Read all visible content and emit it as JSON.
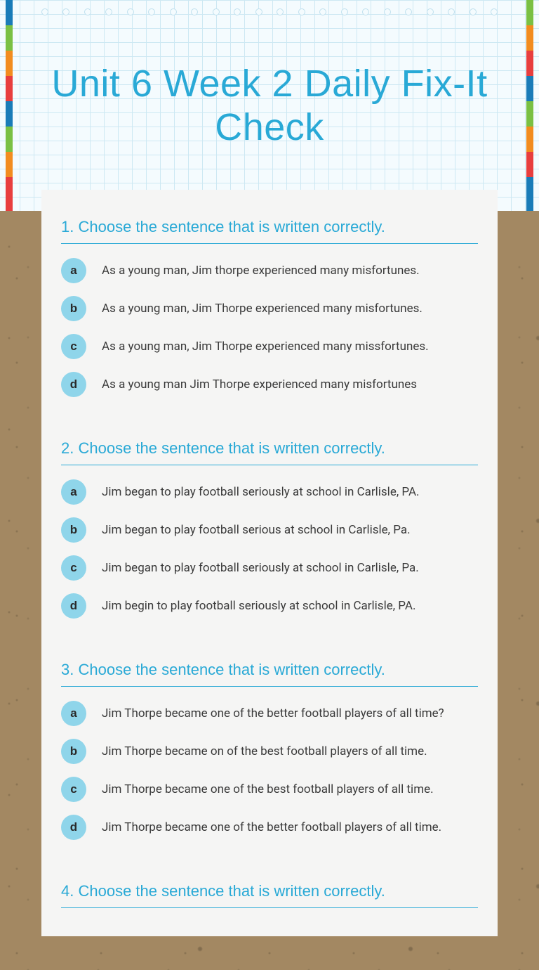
{
  "title": "Unit 6 Week 2 Daily Fix-It Check",
  "questions": [
    {
      "num": "1.",
      "prompt": "Choose the sentence that is written correctly.",
      "options": [
        {
          "letter": "a",
          "text": "As a young man, Jim thorpe experienced many misfortunes."
        },
        {
          "letter": "b",
          "text": "As a young man, Jim Thorpe experienced many misfortunes."
        },
        {
          "letter": "c",
          "text": "As a young man, Jim Thorpe experienced many missfortunes."
        },
        {
          "letter": "d",
          "text": "As a young man Jim Thorpe experienced many misfortunes"
        }
      ]
    },
    {
      "num": "2.",
      "prompt": "Choose the sentence that is written correctly.",
      "options": [
        {
          "letter": "a",
          "text": "Jim began to play football seriously at school in Carlisle, PA."
        },
        {
          "letter": "b",
          "text": "Jim began to play football serious at school in Carlisle, Pa."
        },
        {
          "letter": "c",
          "text": "Jim began to play football seriously at school in Carlisle, Pa."
        },
        {
          "letter": "d",
          "text": "Jim begin to play football seriously at school in Carlisle, PA."
        }
      ]
    },
    {
      "num": "3.",
      "prompt": "Choose the sentence that is written correctly.",
      "options": [
        {
          "letter": "a",
          "text": "Jim Thorpe became one of the better football players of all time?"
        },
        {
          "letter": "b",
          "text": "Jim Thorpe became on of the best football players of all time."
        },
        {
          "letter": "c",
          "text": "Jim Thorpe became one of the best football players of all time."
        },
        {
          "letter": "d",
          "text": "Jim Thorpe became one of the better football players of all time."
        }
      ]
    },
    {
      "num": "4.",
      "prompt": "Choose the sentence that is written correctly.",
      "options": []
    }
  ]
}
